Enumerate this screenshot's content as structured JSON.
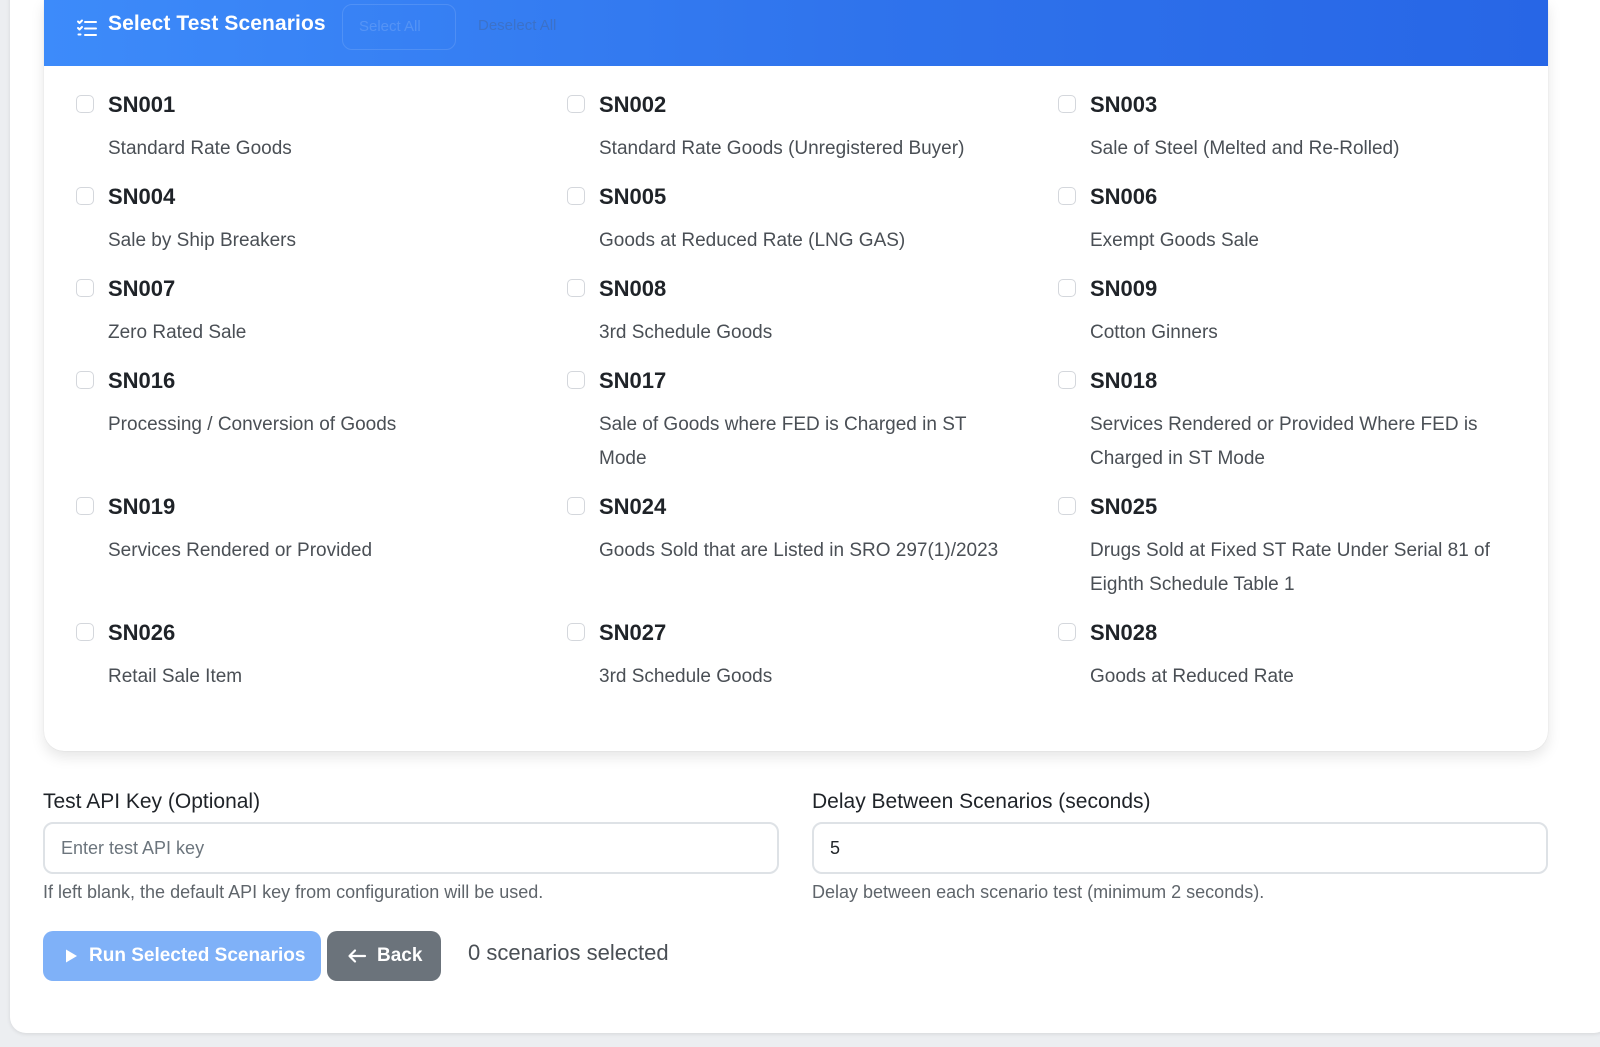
{
  "header": {
    "title": "Select Test Scenarios",
    "select_all": "Select All",
    "deselect_all": "Deselect All",
    "icon": "list-check-icon"
  },
  "scenarios": [
    {
      "code": "SN001",
      "desc": "Standard Rate Goods",
      "checked": false
    },
    {
      "code": "SN002",
      "desc": "Standard Rate Goods (Unregistered Buyer)",
      "checked": false
    },
    {
      "code": "SN003",
      "desc": "Sale of Steel (Melted and Re-Rolled)",
      "checked": false
    },
    {
      "code": "SN004",
      "desc": "Sale by Ship Breakers",
      "checked": false
    },
    {
      "code": "SN005",
      "desc": "Goods at Reduced Rate (LNG GAS)",
      "checked": false
    },
    {
      "code": "SN006",
      "desc": "Exempt Goods Sale",
      "checked": false
    },
    {
      "code": "SN007",
      "desc": "Zero Rated Sale",
      "checked": false
    },
    {
      "code": "SN008",
      "desc": "3rd Schedule Goods",
      "checked": false
    },
    {
      "code": "SN009",
      "desc": "Cotton Ginners",
      "checked": false
    },
    {
      "code": "SN016",
      "desc": "Processing / Conversion of Goods",
      "checked": false
    },
    {
      "code": "SN017",
      "desc": "Sale of Goods where FED is Charged in ST Mode",
      "checked": false
    },
    {
      "code": "SN018",
      "desc": "Services Rendered or Provided Where FED is Charged in ST Mode",
      "checked": false
    },
    {
      "code": "SN019",
      "desc": "Services Rendered or Provided",
      "checked": false
    },
    {
      "code": "SN024",
      "desc": "Goods Sold that are Listed in SRO 297(1)/2023",
      "checked": false
    },
    {
      "code": "SN025",
      "desc": "Drugs Sold at Fixed ST Rate Under Serial 81 of Eighth Schedule Table 1",
      "checked": false
    },
    {
      "code": "SN026",
      "desc": "Retail Sale Item",
      "checked": false
    },
    {
      "code": "SN027",
      "desc": "3rd Schedule Goods",
      "checked": false
    },
    {
      "code": "SN028",
      "desc": "Goods at Reduced Rate",
      "checked": false
    }
  ],
  "api_key": {
    "label": "Test API Key (Optional)",
    "placeholder": "Enter test API key",
    "value": "",
    "help": "If left blank, the default API key from configuration will be used."
  },
  "delay": {
    "label": "Delay Between Scenarios (seconds)",
    "value": "5",
    "help": "Delay between each scenario test (minimum 2 seconds)."
  },
  "actions": {
    "run_label": "Run Selected Scenarios",
    "back_label": "Back",
    "selected_count": "0 scenarios selected"
  },
  "colors": {
    "header_start": "#3d8bfa",
    "header_end": "#2766e6",
    "run_button": "#7fb1f8",
    "back_button": "#6b737b"
  }
}
